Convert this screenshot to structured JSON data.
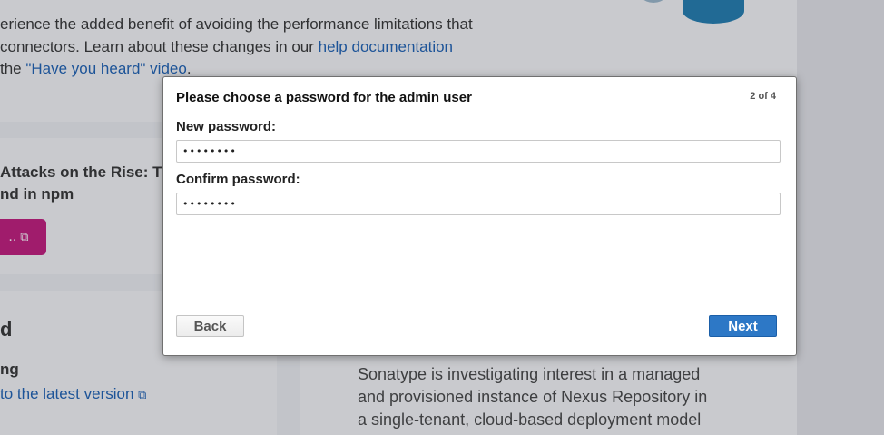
{
  "background": {
    "intro_line1": "erience the added benefit of avoiding the performance limitations that",
    "intro_line2_prefix": " connectors. Learn about these changes in our ",
    "intro_line2_link": "help documentation",
    "intro_line3_prefix": "the ",
    "intro_line3_link": "\"Have you heard\" video",
    "intro_line3_suffix": ".",
    "article_title_line1": "Attacks on the Rise: Top",
    "article_title_line2": "nd in npm",
    "pink_button_label": "..",
    "ext_icon": "⧉",
    "section_heading": "d",
    "section_subheading": "ng",
    "section_link": "to the latest version",
    "right_line1": "Sonatype is investigating interest in a managed",
    "right_line2": "and provisioned instance of Nexus Repository in",
    "right_line3": "a single-tenant, cloud-based deployment model"
  },
  "dialog": {
    "title": "Please choose a password for the admin user",
    "step": "2 of 4",
    "new_password_label": "New password:",
    "new_password_value": "••••••••",
    "confirm_password_label": "Confirm password:",
    "confirm_password_value": "••••••••",
    "back_label": "Back",
    "next_label": "Next"
  }
}
